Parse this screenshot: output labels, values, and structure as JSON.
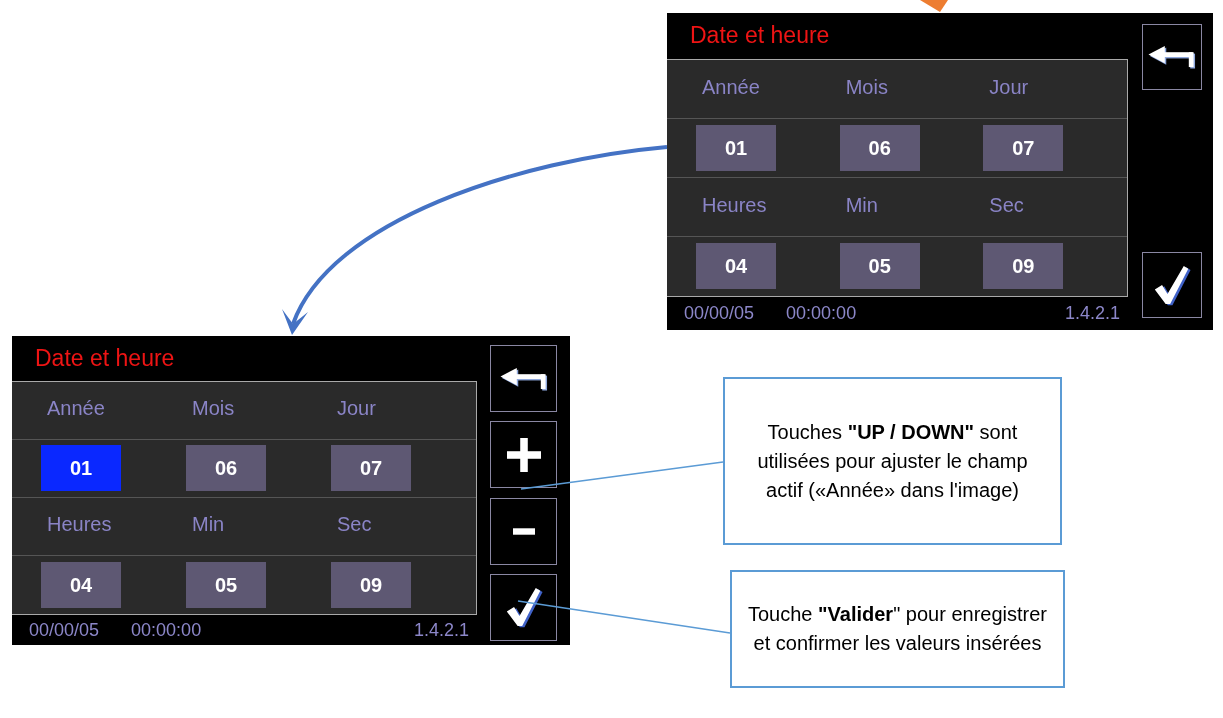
{
  "screens": [
    {
      "title": "Date et heure",
      "fields": [
        {
          "label": "Année",
          "value": "01",
          "selected": false
        },
        {
          "label": "Mois",
          "value": "06",
          "selected": false
        },
        {
          "label": "Jour",
          "value": "07",
          "selected": false
        },
        {
          "label": "Heures",
          "value": "04",
          "selected": false
        },
        {
          "label": "Min",
          "value": "05",
          "selected": false
        },
        {
          "label": "Sec",
          "value": "09",
          "selected": false
        }
      ],
      "buttons": [
        {
          "kind": "back"
        },
        {
          "kind": "confirm"
        }
      ],
      "status_bar": {
        "date": "00/00/05",
        "time": "00:00:00",
        "version": "1.4.2.1"
      }
    },
    {
      "title": "Date et heure",
      "fields": [
        {
          "label": "Année",
          "value": "01",
          "selected": true
        },
        {
          "label": "Mois",
          "value": "06",
          "selected": false
        },
        {
          "label": "Jour",
          "value": "07",
          "selected": false
        },
        {
          "label": "Heures",
          "value": "04",
          "selected": false
        },
        {
          "label": "Min",
          "value": "05",
          "selected": false
        },
        {
          "label": "Sec",
          "value": "09",
          "selected": false
        }
      ],
      "buttons": [
        {
          "kind": "back"
        },
        {
          "kind": "plus"
        },
        {
          "kind": "minus"
        },
        {
          "kind": "confirm"
        }
      ],
      "status_bar": {
        "date": "00/00/05",
        "time": "00:00:00",
        "version": "1.4.2.1"
      }
    }
  ],
  "callouts": [
    {
      "text": "Touches **\"UP / DOWN\"** sont utilisées pour ajuster le champ actif («Année» dans l'image)"
    },
    {
      "text": "Touche **\"Valider**\" pour enregistrer et confirmer les valeurs insérées"
    }
  ]
}
